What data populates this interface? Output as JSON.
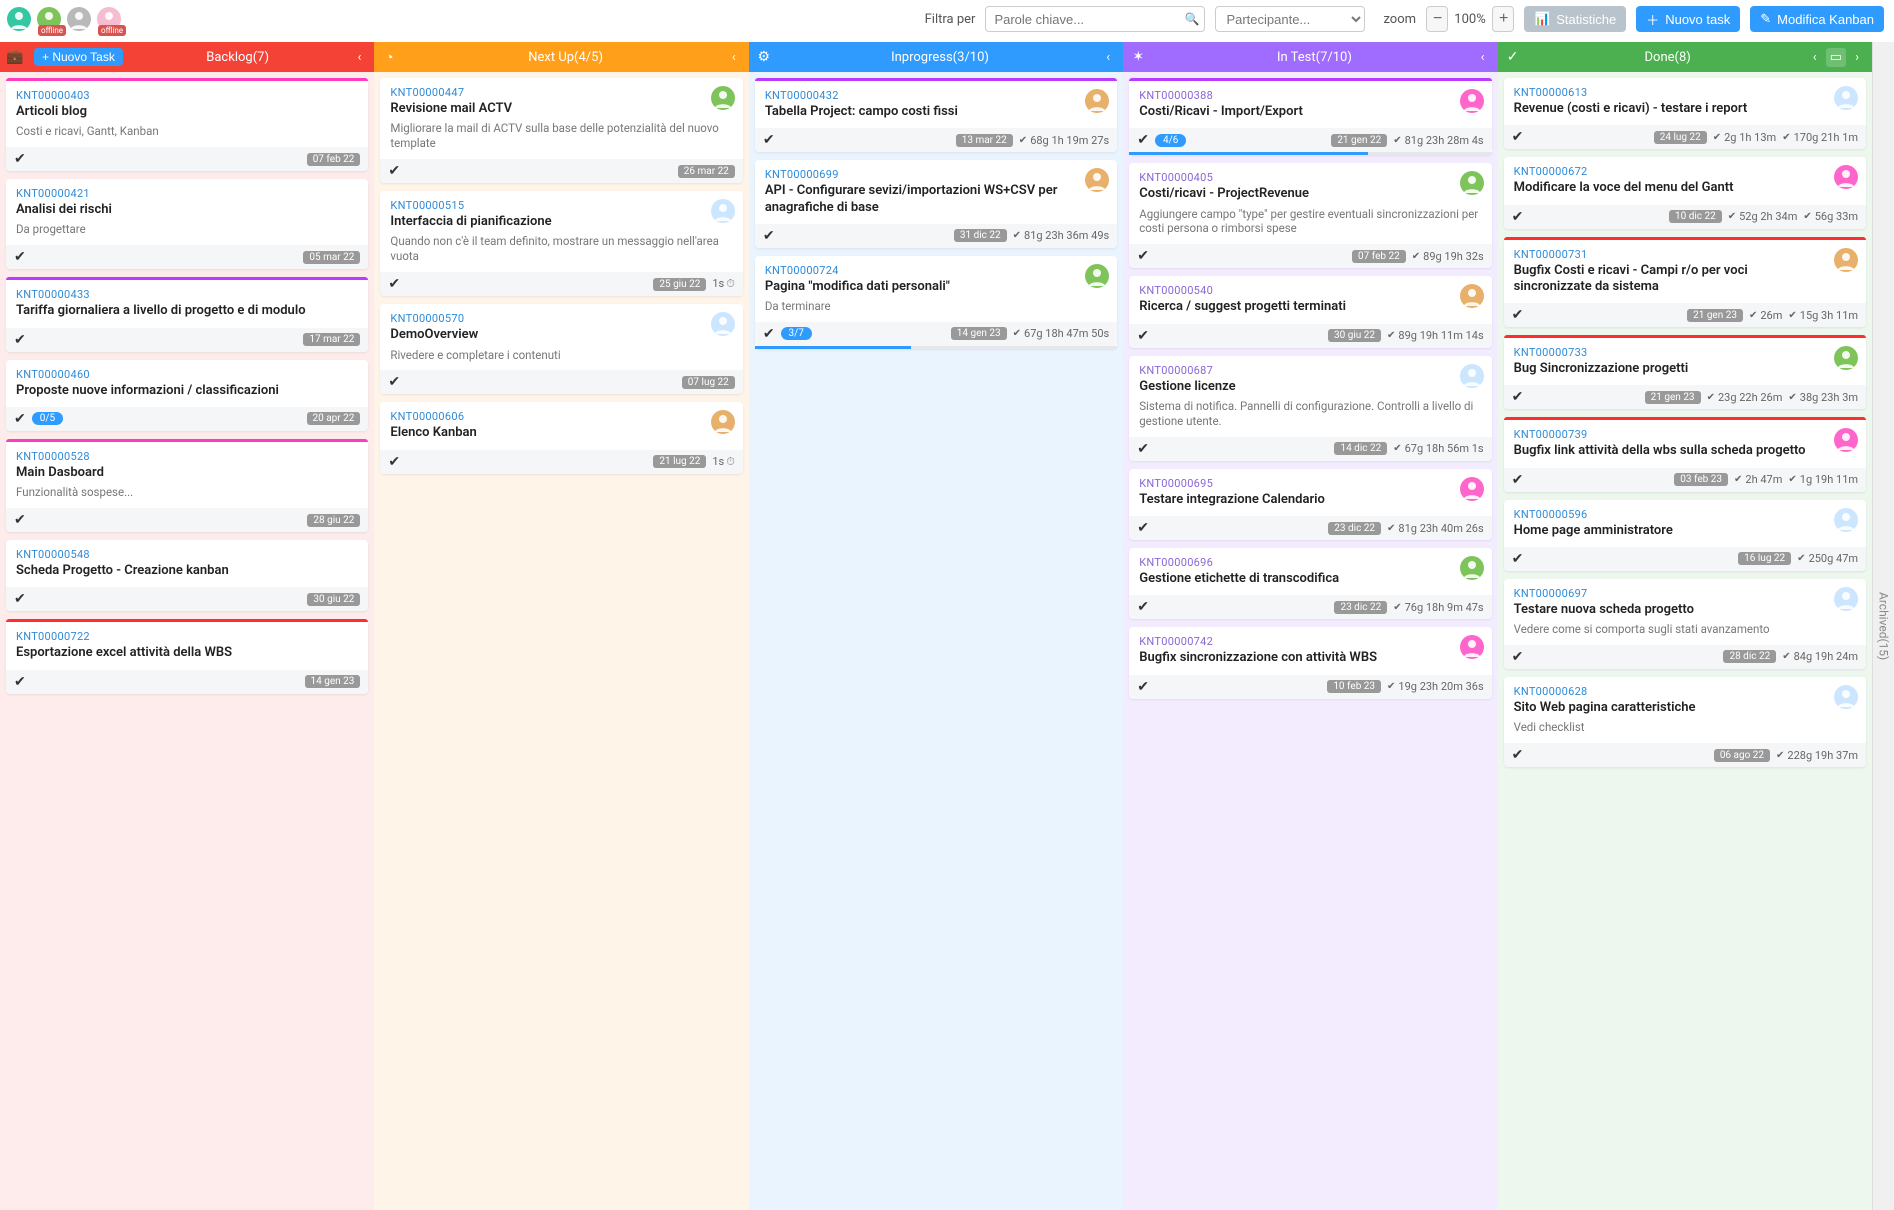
{
  "topbar": {
    "filter_label": "Filtra per",
    "search_placeholder": "Parole chiave...",
    "participant_placeholder": "Partecipante...",
    "zoom_label": "zoom",
    "zoom_value": "100%",
    "stats_label": "Statistiche",
    "new_task_label": "Nuovo task",
    "edit_kanban_label": "Modifica Kanban",
    "avatars": [
      {
        "bg": "#34c7a1",
        "offline": false
      },
      {
        "bg": "#7fc45b",
        "offline": true
      },
      {
        "bg": "#b9b9b9",
        "offline": false
      },
      {
        "bg": "#f7bcd0",
        "offline": true
      }
    ],
    "minus": "−",
    "plus": "+"
  },
  "archived_label": "Archived(15)",
  "columns": [
    {
      "key": "backlog",
      "class": "col-backlog",
      "title": "Backlog(7)",
      "left_icon": "💼",
      "new_task": "+ Nuovo Task",
      "cards": [
        {
          "stripe": "#ff3bbf",
          "id": "KNT00000403",
          "title": "Articoli blog",
          "desc": "Costi e ricavi, Gantt, Kanban",
          "date": "07 feb 22"
        },
        {
          "stripe": null,
          "id": "KNT00000421",
          "title": "Analisi dei rischi",
          "desc": "Da progettare",
          "date": "05 mar 22"
        },
        {
          "stripe": "#b83bff",
          "id": "KNT00000433",
          "title": "Tariffa giornaliera a livello di progetto e di modulo",
          "date": "17 mar 22"
        },
        {
          "stripe": null,
          "id": "KNT00000460",
          "title": "Proposte nuove informazioni / classificazioni",
          "date": "20 apr 22",
          "progress": "0/5"
        },
        {
          "stripe": "#ff3bbf",
          "id": "KNT00000528",
          "title": "Main Dasboard",
          "desc": "Funzionalità sospese...",
          "date": "28 giu 22"
        },
        {
          "stripe": null,
          "id": "KNT00000548",
          "title": "Scheda Progetto - Creazione kanban",
          "date": "30 giu 22"
        },
        {
          "stripe": "#ff2d2d",
          "id": "KNT00000722",
          "title": "Esportazione excel attività della WBS",
          "date": "14 gen 23"
        }
      ]
    },
    {
      "key": "nextup",
      "class": "col-nextup",
      "title": "Next Up(4/5)",
      "left_icon": "◔",
      "cards": [
        {
          "stripe": null,
          "id": "KNT00000447",
          "title": "Revisione mail ACTV",
          "desc": "Migliorare la mail di ACTV sulla base delle potenzialità del nuovo template",
          "date": "26 mar 22",
          "assignee": "#7fc45b"
        },
        {
          "stripe": null,
          "id": "KNT00000515",
          "title": "Interfaccia di pianificazione",
          "desc": "Quando non c'è il team definito, mostrare un messaggio nell'area vuota",
          "date": "25 giu 22",
          "assignee": "#cde6ff",
          "clock": "1s"
        },
        {
          "stripe": null,
          "id": "KNT00000570",
          "title": "DemoOverview",
          "desc": "Rivedere e completare i contenuti",
          "date": "07 lug 22",
          "assignee": "#cde6ff"
        },
        {
          "stripe": null,
          "id": "KNT00000606",
          "title": "Elenco Kanban",
          "date": "21 lug 22",
          "assignee": "#e7b06b",
          "clock": "1s"
        }
      ]
    },
    {
      "key": "inprog",
      "class": "col-inprog",
      "title": "Inprogress(3/10)",
      "left_icon": "⚙",
      "cards": [
        {
          "stripe": "#b83bff",
          "id": "KNT00000432",
          "title": "Tabella Project: campo costi fissi",
          "date": "13 mar 22",
          "dur1": "68g 1h 19m 27s",
          "assignee": "#e7b06b"
        },
        {
          "stripe": null,
          "id": "KNT00000699",
          "title": "API - Configurare sevizi/importazioni WS+CSV per anagrafiche di base",
          "date": "31 dic 22",
          "dur1": "81g 23h 36m 49s",
          "assignee": "#e7b06b"
        },
        {
          "stripe": null,
          "id": "KNT00000724",
          "title": "Pagina \"modifica dati personali\"",
          "desc": "Da terminare",
          "date": "14 gen 23",
          "dur1": "67g 18h 47m 50s",
          "assignee": "#7fc45b",
          "progress": "3/7",
          "progressPct": 43
        }
      ]
    },
    {
      "key": "intest",
      "class": "col-intest",
      "title": "In Test(7/10)",
      "left_icon": "✶",
      "cards": [
        {
          "stripe": "#b83bff",
          "id": "KNT00000388",
          "title": "Costi/Ricavi - Import/Export",
          "date": "21 gen 22",
          "dur1": "81g 23h 28m 4s",
          "assignee": "#ff66cc",
          "progress": "4/6",
          "progressPct": 66
        },
        {
          "stripe": null,
          "id": "KNT00000405",
          "title": "Costi/ricavi - ProjectRevenue",
          "desc": "Aggiungere campo \"type\" per gestire eventuali sincronizzazioni per costi persona o rimborsi spese",
          "date": "07 feb 22",
          "dur1": "89g 19h 32s",
          "assignee": "#7fc45b"
        },
        {
          "stripe": null,
          "id": "KNT00000540",
          "title": "Ricerca / suggest progetti terminati",
          "date": "30 giu 22",
          "dur1": "89g 19h 11m 14s",
          "assignee": "#e7b06b"
        },
        {
          "stripe": null,
          "id": "KNT00000687",
          "title": "Gestione licenze",
          "desc": "Sistema di notifica. Pannelli di configurazione. Controlli a livello di gestione utente.",
          "date": "14 dic 22",
          "dur1": "67g 18h 56m 1s",
          "assignee": "#cde6ff"
        },
        {
          "stripe": null,
          "id": "KNT00000695",
          "title": "Testare integrazione Calendario",
          "date": "23 dic 22",
          "dur1": "81g 23h 40m 26s",
          "assignee": "#ff66cc"
        },
        {
          "stripe": null,
          "id": "KNT00000696",
          "title": "Gestione etichette di transcodifica",
          "date": "23 dic 22",
          "dur1": "76g 18h 9m 47s",
          "assignee": "#7fc45b"
        },
        {
          "stripe": null,
          "id": "KNT00000742",
          "title": "Bugfix sincronizzazione con attività WBS",
          "date": "10 feb 23",
          "dur1": "19g 23h 20m 36s",
          "assignee": "#ff66cc"
        }
      ]
    },
    {
      "key": "done",
      "class": "col-done",
      "title": "Done(8)",
      "left_icon": "✓",
      "extra_right_icon": true,
      "cards": [
        {
          "stripe": null,
          "id": "KNT00000613",
          "title": "Revenue (costi e ricavi) - testare i report",
          "date": "24 lug 22",
          "dur1": "2g 1h 13m",
          "dur2": "170g 21h 1m",
          "assignee": "#cde6ff"
        },
        {
          "stripe": null,
          "id": "KNT00000672",
          "title": "Modificare la voce del menu del Gantt",
          "date": "10 dic 22",
          "dur1": "52g 2h 34m",
          "dur2": "56g 33m",
          "assignee": "#ff66cc"
        },
        {
          "stripe": "#ff2d2d",
          "id": "KNT00000731",
          "title": "Bugfix Costi e ricavi - Campi r/o per voci sincronizzate da sistema",
          "date": "21 gen 23",
          "dur1": "26m",
          "dur2": "15g 3h 11m",
          "assignee": "#e7b06b"
        },
        {
          "stripe": "#ff2d2d",
          "id": "KNT00000733",
          "title": "Bug Sincronizzazione progetti",
          "date": "21 gen 23",
          "dur1": "23g 22h 26m",
          "dur2": "38g 23h 3m",
          "assignee": "#7fc45b"
        },
        {
          "stripe": "#ff2d2d",
          "id": "KNT00000739",
          "title": "Bugfix link attività della wbs sulla scheda progetto",
          "date": "03 feb 23",
          "dur1": "2h 47m",
          "dur2": "1g 19h 11m",
          "assignee": "#ff66cc"
        },
        {
          "stripe": null,
          "id": "KNT00000596",
          "title": "Home page amministratore",
          "date": "16 lug 22",
          "dur1": "250g 47m",
          "assignee": "#cde6ff"
        },
        {
          "stripe": null,
          "id": "KNT00000697",
          "title": "Testare nuova scheda progetto",
          "desc": "Vedere come si comporta sugli stati avanzamento",
          "date": "28 dic 22",
          "dur1": "84g 19h 24m",
          "assignee": "#cde6ff"
        },
        {
          "stripe": null,
          "id": "KNT00000628",
          "title": "Sito Web pagina caratteristiche",
          "desc": "Vedi checklist",
          "date": "06 ago 22",
          "dur1": "228g 19h 37m",
          "assignee": "#cde6ff"
        }
      ]
    }
  ]
}
